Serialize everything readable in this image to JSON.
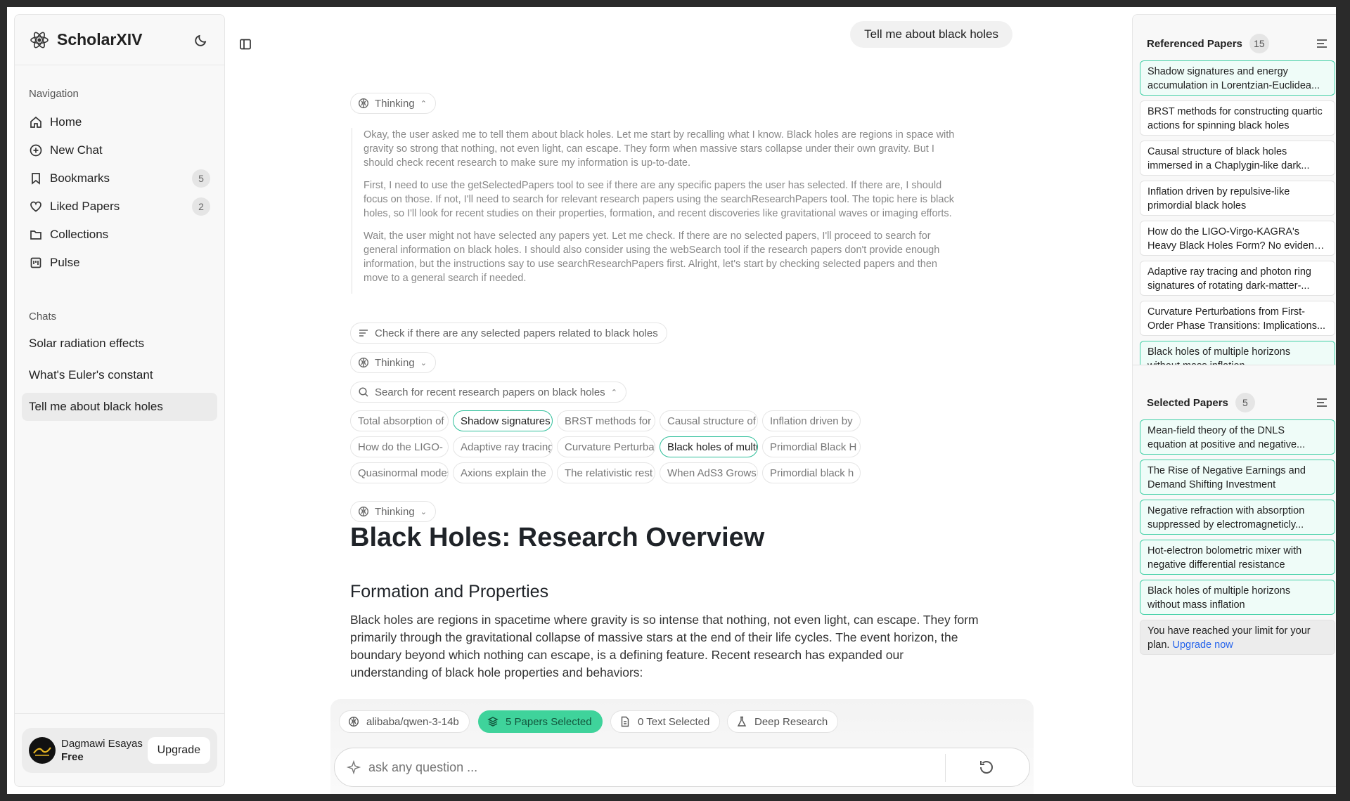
{
  "brand": {
    "name": "ScholarXIV"
  },
  "sidebar": {
    "nav_label": "Navigation",
    "items": [
      {
        "label": "Home",
        "icon": "home-icon"
      },
      {
        "label": "New Chat",
        "icon": "plus-circle-icon"
      },
      {
        "label": "Bookmarks",
        "icon": "bookmark-icon",
        "badge": "5"
      },
      {
        "label": "Liked Papers",
        "icon": "heart-icon",
        "badge": "2"
      },
      {
        "label": "Collections",
        "icon": "folder-icon"
      },
      {
        "label": "Pulse",
        "icon": "pulse-icon"
      }
    ],
    "chats_label": "Chats",
    "chats": [
      "Solar radiation effects",
      "What's Euler's constant",
      "Tell me about black holes"
    ],
    "user": {
      "name": "Dagmawi Esayas",
      "plan": "Free",
      "upgrade": "Upgrade"
    }
  },
  "chat": {
    "user_message": "Tell me about black holes",
    "thinking_label": "Thinking",
    "thinking_paragraphs": [
      "Okay, the user asked me to tell them about black holes. Let me start by recalling what I know. Black holes are regions in space with gravity so strong that nothing, not even light, can escape. They form when massive stars collapse under their own gravity. But I should check recent research to make sure my information is up-to-date.",
      "First, I need to use the getSelectedPapers tool to see if there are any specific papers the user has selected. If there are, I should focus on those. If not, I'll need to search for relevant research papers using the searchResearchPapers tool. The topic here is black holes, so I'll look for recent studies on their properties, formation, and recent discoveries like gravitational waves or imaging efforts.",
      "Wait, the user might not have selected any papers yet. Let me check. If there are no selected papers, I'll proceed to search for general information on black holes. I should also consider using the webSearch tool if the research papers don't provide enough information, but the instructions say to use searchResearchPapers first. Alright, let's start by checking selected papers and then move to a general search if needed."
    ],
    "step_check": "Check if there are any selected papers related to black holes",
    "step_search": "Search for recent research papers on black holes",
    "search_results": [
      "Total absorption of",
      "Shadow signatures",
      "BRST methods for",
      "Causal structure of",
      "Inflation driven by",
      "How do the LIGO-",
      "Adaptive ray tracing",
      "Curvature Perturbations",
      "Black holes of multiple",
      "Primordial Black H",
      "Quasinormal modes",
      "Axions explain the",
      "The relativistic rest",
      "When AdS3 Grows",
      "Primordial black h"
    ],
    "answer_title": "Black Holes: Research Overview",
    "answer_section": "Formation and Properties",
    "answer_paragraph": "Black holes are regions in spacetime where gravity is so intense that nothing, not even light, can escape. They form primarily through the gravitational collapse of massive stars at the end of their life cycles. The event horizon, the boundary beyond which nothing can escape, is a defining feature. Recent research has expanded our understanding of black hole properties and behaviors:"
  },
  "composer": {
    "model": "alibaba/qwen-3-14b",
    "papers_selected": "5 Papers Selected",
    "text_selected": "0 Text Selected",
    "deep_research": "Deep Research",
    "placeholder": "ask any question ..."
  },
  "referenced": {
    "title": "Referenced Papers",
    "count": "15",
    "papers": [
      {
        "l1": "Shadow signatures and energy",
        "l2": "accumulation in Lorentzian-Euclidea...",
        "sel": true
      },
      {
        "l1": "BRST methods for constructing quartic",
        "l2": "actions for spinning black holes",
        "sel": false
      },
      {
        "l1": "Causal structure of black holes",
        "l2": "immersed in a Chaplygin-like dark...",
        "sel": false
      },
      {
        "l1": "Inflation driven by repulsive-like",
        "l2": "primordial black holes",
        "sel": false
      },
      {
        "l1": "How do the LIGO-Virgo-KAGRA's",
        "l2": "Heavy Black Holes Form? No evidenc...",
        "sel": false
      },
      {
        "l1": "Adaptive ray tracing and photon ring",
        "l2": "signatures of rotating dark-matter-...",
        "sel": false
      },
      {
        "l1": "Curvature Perturbations from First-",
        "l2": "Order Phase Transitions: Implications...",
        "sel": false
      },
      {
        "l1": "Black holes of multiple horizons",
        "l2": "without mass inflation",
        "sel": true
      }
    ]
  },
  "selected": {
    "title": "Selected Papers",
    "count": "5",
    "papers": [
      {
        "l1": "Mean-field theory of the DNLS",
        "l2": "equation at positive and negative..."
      },
      {
        "l1": "The Rise of Negative Earnings and",
        "l2": "Demand Shifting Investment"
      },
      {
        "l1": "Negative refraction with absorption",
        "l2": "suppressed by electromagneticly..."
      },
      {
        "l1": "Hot-electron bolometric mixer with",
        "l2": "negative differential resistance"
      },
      {
        "l1": "Black holes of multiple horizons",
        "l2": "without mass inflation"
      }
    ],
    "limit_text": "You have reached your limit for your plan.",
    "limit_link": "Upgrade now"
  }
}
